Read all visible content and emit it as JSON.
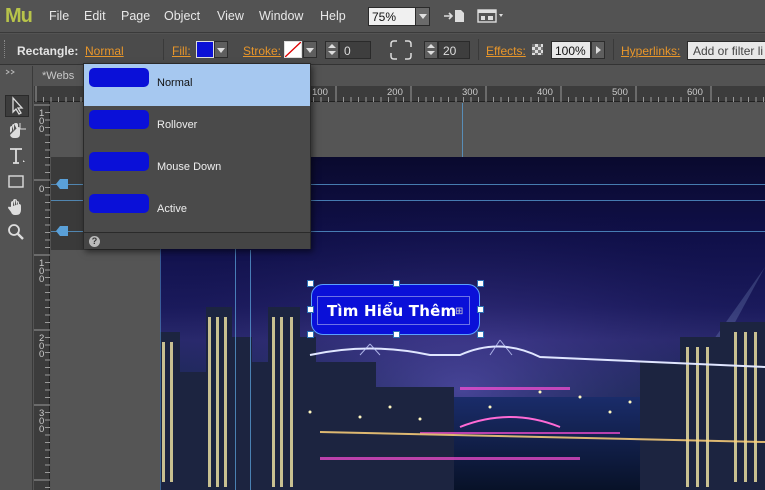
{
  "app": {
    "logo": "Mu"
  },
  "menu": [
    "File",
    "Edit",
    "Page",
    "Object",
    "View",
    "Window",
    "Help"
  ],
  "zoom": {
    "value": "75%"
  },
  "control_bar": {
    "object_type_label": "Rectangle:",
    "state_link": "Normal",
    "fill_label": "Fill:",
    "fill_color": "#0b10d6",
    "stroke_label": "Stroke:",
    "stroke_width": "0",
    "corner_radius": "20",
    "effects_label": "Effects:",
    "opacity": "100%",
    "hyperlinks_label": "Hyperlinks:",
    "hyperlinks_placeholder": "Add or filter li"
  },
  "document_tab": "*Webs",
  "states_panel": {
    "states": [
      {
        "label": "Normal",
        "selected": true
      },
      {
        "label": "Rollover",
        "selected": false
      },
      {
        "label": "Mouse Down",
        "selected": false
      },
      {
        "label": "Active",
        "selected": false
      }
    ],
    "help": "?"
  },
  "ruler": {
    "h_labels": [
      "100",
      "200",
      "300",
      "400",
      "500",
      "600"
    ],
    "v_labels": [
      "1\n0\n0",
      "0",
      "1\n0\n0",
      "2\n0\n0",
      "3\n0\n0"
    ]
  },
  "canvas": {
    "button_text": "Tìm Hiểu Thêm",
    "button_color": "#0a10d8"
  }
}
